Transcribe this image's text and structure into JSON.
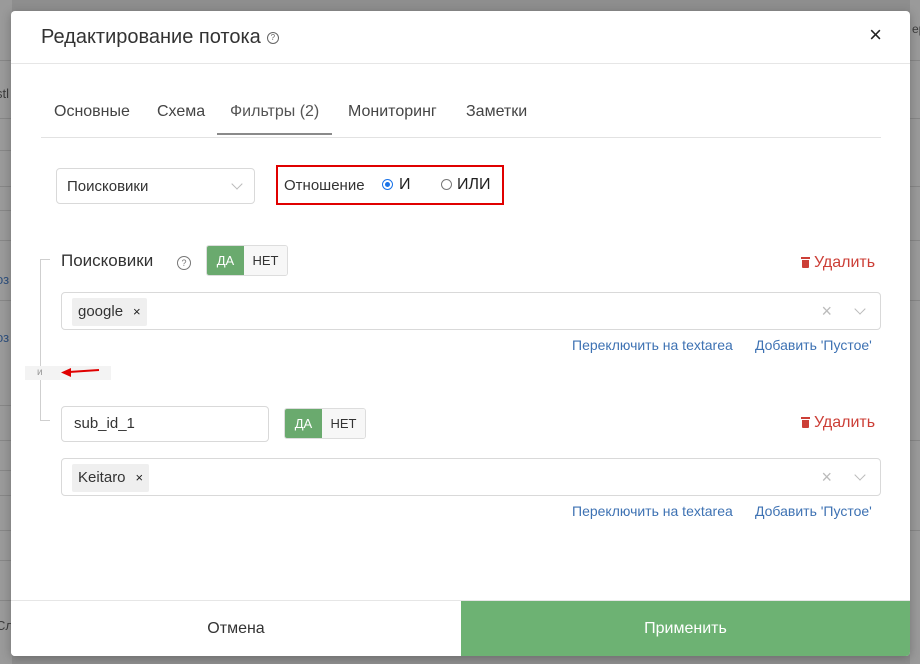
{
  "modal": {
    "title": "Редактирование потока",
    "close_label": "×"
  },
  "background": {
    "left_text_1": "stl",
    "left_link_1": "оз",
    "left_link_2": "оз",
    "left_text_2": "Сл",
    "right_text_1": "ерп"
  },
  "tabs": [
    {
      "label": "Основные"
    },
    {
      "label": "Схема"
    },
    {
      "label": "Фильтры (2)"
    },
    {
      "label": "Мониторинг"
    },
    {
      "label": "Заметки"
    }
  ],
  "filter_select": {
    "value": "Поисковики"
  },
  "relation": {
    "label": "Отношение",
    "options": [
      {
        "label": "И",
        "checked": true
      },
      {
        "label": "ИЛИ",
        "checked": false
      }
    ]
  },
  "connector_label": "и",
  "filters": [
    {
      "name": "Поисковики",
      "yes_label": "ДА",
      "no_label": "НЕТ",
      "delete_label": "Удалить",
      "tags": [
        "google"
      ],
      "switch_link": "Переключить на textarea",
      "add_empty_link": "Добавить 'Пустое'"
    },
    {
      "name": "sub_id_1",
      "yes_label": "ДА",
      "no_label": "НЕТ",
      "delete_label": "Удалить",
      "tags": [
        "Keitaro"
      ],
      "switch_link": "Переключить на textarea",
      "add_empty_link": "Добавить 'Пустое'"
    }
  ],
  "footer": {
    "cancel_label": "Отмена",
    "apply_label": "Применить"
  },
  "colors": {
    "accent_green": "#6db273",
    "highlight_red": "#e00000",
    "delete_red": "#cc3e36",
    "link_blue": "#3e72b3"
  }
}
